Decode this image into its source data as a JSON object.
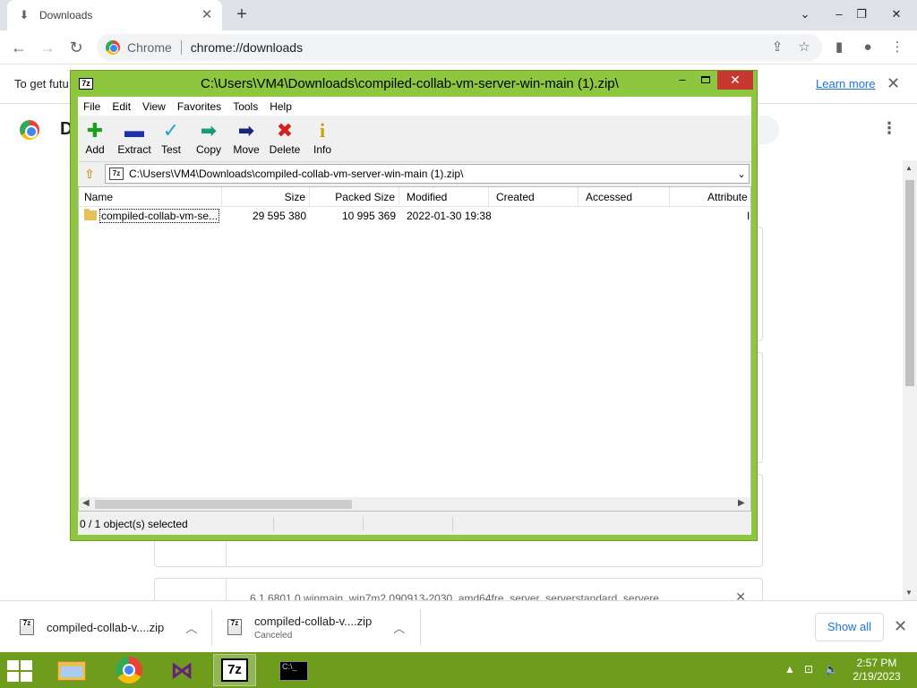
{
  "browser": {
    "tab": {
      "title": "Downloads",
      "icon": "download-icon"
    },
    "address": {
      "site_label": "Chrome",
      "url": "chrome://downloads"
    }
  },
  "infobar": {
    "text": "To get futu",
    "link": "Learn more"
  },
  "page": {
    "title": "D",
    "cards": [
      {
        "filename": ""
      },
      {
        "filename": ""
      },
      {
        "filename": "6.1.6801.0.winmain_win7m2.090913-2030_amd64fre_server_serverstandard_servere"
      }
    ]
  },
  "sevenzip": {
    "app_icon_label": "7z",
    "title": "C:\\Users\\VM4\\Downloads\\compiled-collab-vm-server-win-main (1).zip\\",
    "menu": [
      "File",
      "Edit",
      "View",
      "Favorites",
      "Tools",
      "Help"
    ],
    "toolbar": {
      "add": "Add",
      "extract": "Extract",
      "test": "Test",
      "copy": "Copy",
      "move": "Move",
      "delete": "Delete",
      "info": "Info"
    },
    "path": "C:\\Users\\VM4\\Downloads\\compiled-collab-vm-server-win-main (1).zip\\",
    "columns": {
      "name": "Name",
      "size": "Size",
      "packed": "Packed Size",
      "modified": "Modified",
      "created": "Created",
      "accessed": "Accessed",
      "attributes": "Attribute"
    },
    "rows": [
      {
        "name": "compiled-collab-vm-se...",
        "size": "29 595 380",
        "packed": "10 995 369",
        "modified": "2022-01-30 19:38",
        "created": "",
        "accessed": "",
        "attributes": "I"
      }
    ],
    "status": "0 / 1 object(s) selected"
  },
  "shelf": {
    "items": [
      {
        "name": "compiled-collab-v....zip",
        "status": ""
      },
      {
        "name": "compiled-collab-v....zip",
        "status": "Canceled"
      }
    ],
    "show_all": "Show all"
  },
  "taskbar": {
    "apps": [
      "file-explorer-icon",
      "chrome-icon",
      "visual-studio-icon",
      "7zip-icon",
      "command-prompt-icon"
    ],
    "time": "2:57 PM",
    "date": "2/19/2023"
  }
}
